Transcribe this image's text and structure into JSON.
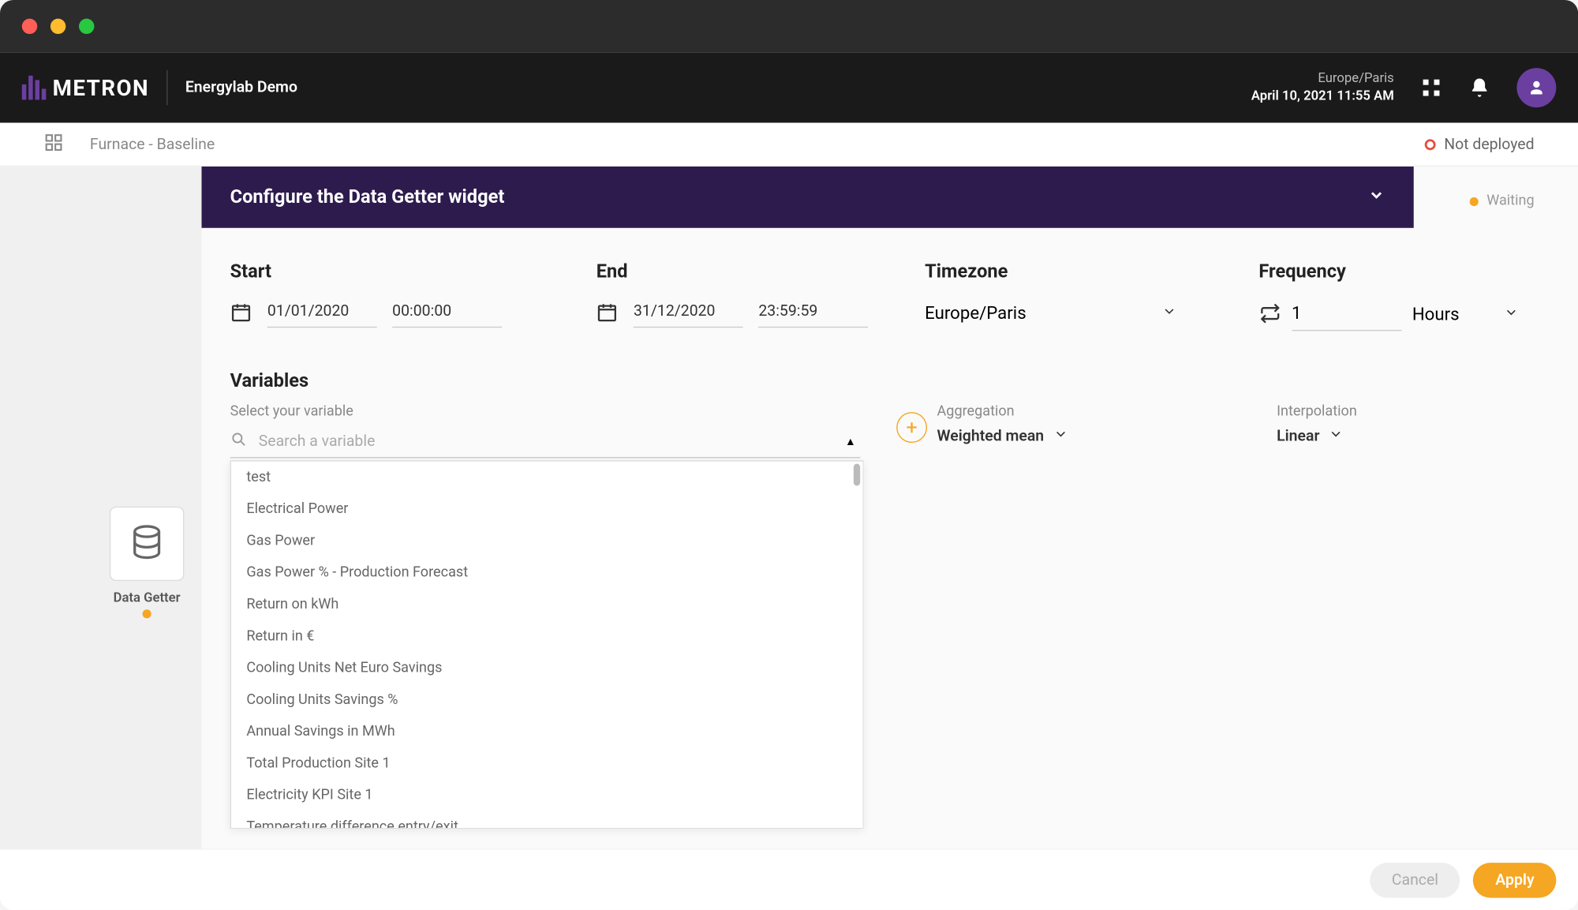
{
  "header": {
    "brand": "METRON",
    "project": "Energylab Demo",
    "timezone_label": "Europe/Paris",
    "datetime": "April 10, 2021 11:55 AM"
  },
  "subbar": {
    "title": "Furnace - Baseline",
    "deploy_status": "Not deployed"
  },
  "panel": {
    "title": "Configure the Data Getter widget",
    "status": "Waiting"
  },
  "widget": {
    "label": "Data Getter"
  },
  "form": {
    "start_label": "Start",
    "start_date": "01/01/2020",
    "start_time": "00:00:00",
    "end_label": "End",
    "end_date": "31/12/2020",
    "end_time": "23:59:59",
    "tz_label": "Timezone",
    "tz_value": "Europe/Paris",
    "freq_label": "Frequency",
    "freq_value": "1",
    "freq_unit": "Hours",
    "vars_label": "Variables",
    "select_var_label": "Select your variable",
    "search_placeholder": "Search a variable",
    "agg_label": "Aggregation",
    "agg_value": "Weighted mean",
    "int_label": "Interpolation",
    "int_value": "Linear"
  },
  "variables": [
    "test",
    "Electrical Power",
    "Gas Power",
    "Gas Power % - Production Forecast",
    "Return on kWh",
    "Return in €",
    "Cooling Units Net Euro Savings",
    "Cooling Units Savings %",
    "Annual Savings in MWh",
    "Total Production Site 1",
    "Electricity KPI Site 1",
    "Temperature difference entry/exit"
  ],
  "footer": {
    "cancel": "Cancel",
    "apply": "Apply"
  }
}
